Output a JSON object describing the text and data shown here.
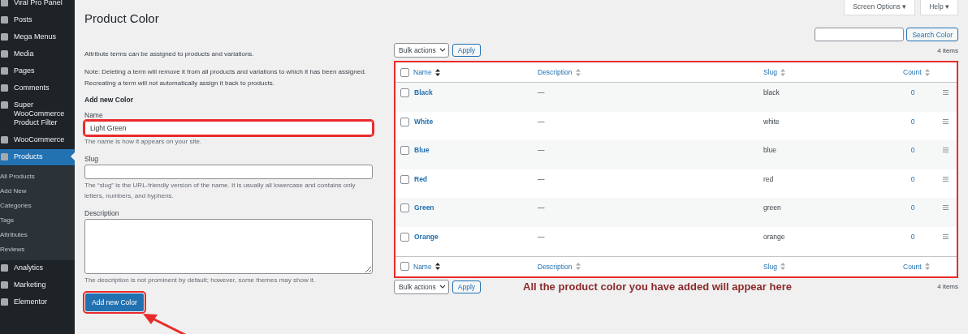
{
  "sidebar": {
    "items": [
      {
        "label": "Viral Pro Panel",
        "selected": false
      },
      {
        "label": "Posts",
        "selected": false
      },
      {
        "label": "Mega Menus",
        "selected": false
      },
      {
        "label": "Media",
        "selected": false
      },
      {
        "label": "Pages",
        "selected": false
      },
      {
        "label": "Comments",
        "selected": false
      },
      {
        "label": "Super WooCommerce Product Filter",
        "selected": false
      },
      {
        "label": "WooCommerce",
        "selected": false
      },
      {
        "label": "Products",
        "selected": true,
        "children": [
          {
            "label": "All Products",
            "selected": false
          },
          {
            "label": "Add New",
            "selected": false
          },
          {
            "label": "Categories",
            "selected": false
          },
          {
            "label": "Tags",
            "selected": false
          },
          {
            "label": "Attributes",
            "selected": false
          },
          {
            "label": "Reviews",
            "selected": false
          }
        ]
      },
      {
        "label": "Analytics",
        "selected": false
      },
      {
        "label": "Marketing",
        "selected": false
      },
      {
        "label": "Elementor",
        "selected": false
      }
    ]
  },
  "page_title": "Product Color",
  "header_buttons": [
    "Screen Options ▾",
    "Help ▾"
  ],
  "form": {
    "intro": "Attribute terms can be assigned to products and variations.",
    "note": "Note: Deleting a term will remove it from all products and variations to which it has been assigned. Recreating a term will not automatically assign it back to products.",
    "heading": "Add new Color",
    "fields": [
      {
        "kind": "input",
        "label": "Name",
        "value": "Light Green",
        "hint": "The name is how it appears on your site.",
        "highlighted": true
      },
      {
        "kind": "input",
        "label": "Slug",
        "hint": "The “slug” is the URL-friendly version of the name. It is usually all lowercase and contains only letters, numbers, and hyphens.",
        "highlighted": false
      },
      {
        "kind": "textarea",
        "label": "Description",
        "hint": "The description is not prominent by default; however, some themes may show it.",
        "highlighted": false
      }
    ],
    "submit": "Add new Color"
  },
  "search": {
    "button": "Search Color"
  },
  "top_nav": {
    "bulk": "Bulk actions",
    "apply": "Apply",
    "count": "4 items"
  },
  "table": {
    "header": {
      "checked": false,
      "columns": [
        {
          "label": "Name",
          "sorted": true
        },
        {
          "label": "Description",
          "sorted": false
        },
        {
          "label": "Slug",
          "sorted": false
        },
        {
          "label": "Count",
          "sorted": false
        }
      ]
    },
    "footer": {
      "checked": false,
      "columns": [
        {
          "label": "Name",
          "sorted": true
        },
        {
          "label": "Description",
          "sorted": false
        },
        {
          "label": "Slug",
          "sorted": false
        },
        {
          "label": "Count",
          "sorted": false
        }
      ]
    },
    "rows": [
      {
        "name": "Black",
        "description": "—",
        "slug": "black",
        "count": "0",
        "checked": false
      },
      {
        "name": "White",
        "description": "—",
        "slug": "white",
        "count": "0",
        "checked": false
      },
      {
        "name": "Blue",
        "description": "—",
        "slug": "blue",
        "count": "0",
        "checked": false
      },
      {
        "name": "Red",
        "description": "—",
        "slug": "red",
        "count": "0",
        "checked": false
      },
      {
        "name": "Green",
        "description": "—",
        "slug": "green",
        "count": "0",
        "checked": false
      },
      {
        "name": "Orange",
        "description": "—",
        "slug": "orange",
        "count": "0",
        "checked": false
      }
    ]
  },
  "bottom_nav": {
    "bulk": "Bulk actions",
    "apply": "Apply",
    "count": "4 items"
  },
  "annotation": "All the product color you have added will appear here"
}
